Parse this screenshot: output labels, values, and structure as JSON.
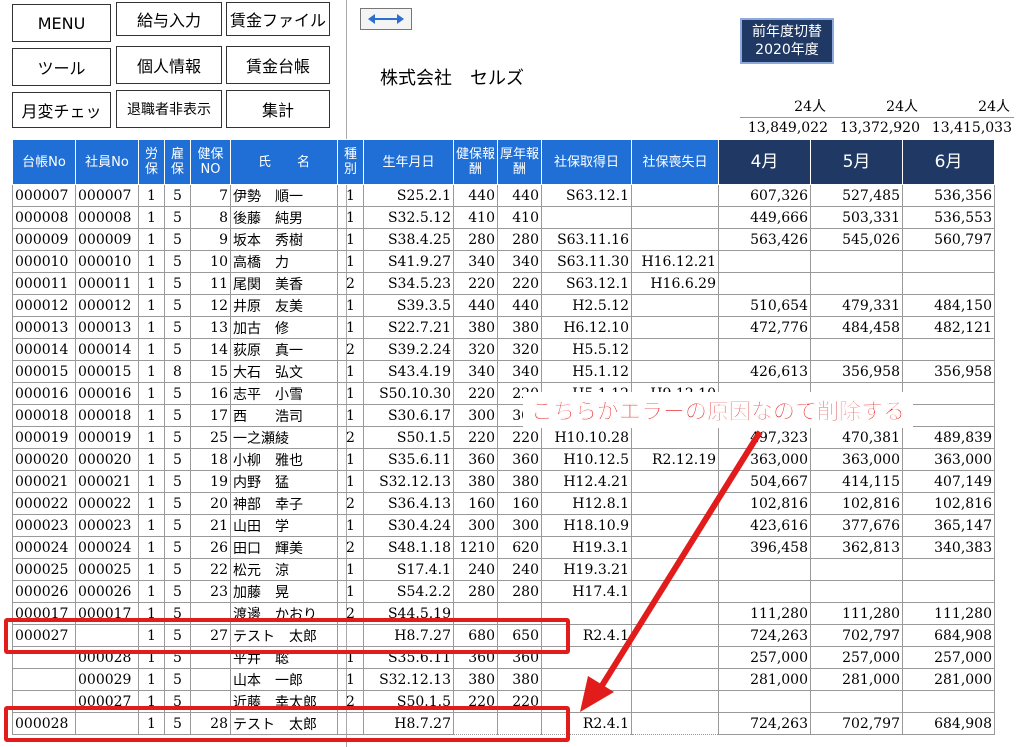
{
  "buttons": {
    "menu": "MENU",
    "salary_input": "給与入力",
    "wage_file": "賃金ファイル",
    "tools": "ツール",
    "personal_info": "個人情報",
    "wage_ledger": "賃金台帳",
    "monthly_change_check": "月変チェッ",
    "hide_retired": "退職者非表示",
    "aggregate": "集計"
  },
  "prev_year": {
    "line1": "前年度切替",
    "line2": "2020年度"
  },
  "company_name": "株式会社　セルズ",
  "headcount": [
    "24人",
    "24人",
    "24人"
  ],
  "totals": [
    "13,849,022",
    "13,372,920",
    "13,415,033"
  ],
  "columns": [
    "台帳No",
    "社員No",
    "労保",
    "雇保",
    "健保NO",
    "氏　　名",
    "種別",
    "生年月日",
    "健保報酬",
    "厚年報酬",
    "社保取得日",
    "社保喪失日",
    "4月",
    "5月",
    "6月"
  ],
  "rows": [
    [
      "000007",
      "000007",
      "1",
      "5",
      "7",
      "伊勢　順一",
      "1",
      "S25.2.1",
      "440",
      "440",
      "S63.12.1",
      "",
      "607,326",
      "527,485",
      "536,356"
    ],
    [
      "000008",
      "000008",
      "1",
      "5",
      "8",
      "後藤　純男",
      "1",
      "S32.5.12",
      "410",
      "410",
      "",
      "",
      "449,666",
      "503,331",
      "536,553"
    ],
    [
      "000009",
      "000009",
      "1",
      "5",
      "9",
      "坂本　秀樹",
      "1",
      "S38.4.25",
      "280",
      "280",
      "S63.11.16",
      "",
      "563,426",
      "545,026",
      "560,797"
    ],
    [
      "000010",
      "000010",
      "1",
      "5",
      "10",
      "高橋　力",
      "1",
      "S41.9.27",
      "340",
      "340",
      "S63.11.30",
      "H16.12.21",
      "",
      "",
      ""
    ],
    [
      "000011",
      "000011",
      "1",
      "5",
      "11",
      "尾関　美香",
      "2",
      "S34.5.23",
      "220",
      "220",
      "S63.12.1",
      "H16.6.29",
      "",
      "",
      ""
    ],
    [
      "000012",
      "000012",
      "1",
      "5",
      "12",
      "井原　友美",
      "1",
      "S39.3.5",
      "440",
      "440",
      "H2.5.12",
      "",
      "510,654",
      "479,331",
      "484,150"
    ],
    [
      "000013",
      "000013",
      "1",
      "5",
      "13",
      "加古　修",
      "1",
      "S22.7.21",
      "380",
      "380",
      "H6.12.10",
      "",
      "472,776",
      "484,458",
      "482,121"
    ],
    [
      "000014",
      "000014",
      "1",
      "5",
      "14",
      "荻原　真一",
      "2",
      "S39.2.24",
      "320",
      "320",
      "H5.5.12",
      "",
      "",
      "",
      ""
    ],
    [
      "000015",
      "000015",
      "1",
      "8",
      "15",
      "大石　弘文",
      "1",
      "S43.4.19",
      "340",
      "340",
      "H5.1.12",
      "",
      "426,613",
      "356,958",
      "356,958"
    ],
    [
      "000016",
      "000016",
      "1",
      "5",
      "16",
      "志平　小雪",
      "1",
      "S50.10.30",
      "220",
      "220",
      "H5.1.12",
      "H9.12.10",
      "",
      "",
      ""
    ],
    [
      "000018",
      "000018",
      "1",
      "5",
      "17",
      "西　　浩司",
      "1",
      "S30.6.17",
      "300",
      "300",
      "H9.2.21",
      "",
      "",
      "",
      ""
    ],
    [
      "000019",
      "000019",
      "1",
      "5",
      "25",
      "一之瀬綾",
      "2",
      "S50.1.5",
      "220",
      "220",
      "H10.10.28",
      "",
      "497,323",
      "470,381",
      "489,839"
    ],
    [
      "000020",
      "000020",
      "1",
      "5",
      "18",
      "小柳　雅也",
      "1",
      "S35.6.11",
      "360",
      "360",
      "H10.12.5",
      "R2.12.19",
      "363,000",
      "363,000",
      "363,000"
    ],
    [
      "000021",
      "000021",
      "1",
      "5",
      "19",
      "内野　猛",
      "1",
      "S32.12.13",
      "380",
      "380",
      "H12.4.21",
      "",
      "504,667",
      "414,115",
      "407,149"
    ],
    [
      "000022",
      "000022",
      "1",
      "5",
      "20",
      "神部　幸子",
      "2",
      "S36.4.13",
      "160",
      "160",
      "H12.8.1",
      "",
      "102,816",
      "102,816",
      "102,816"
    ],
    [
      "000023",
      "000023",
      "1",
      "5",
      "21",
      "山田　学",
      "1",
      "S30.4.24",
      "300",
      "300",
      "H18.10.9",
      "",
      "423,616",
      "377,676",
      "365,147"
    ],
    [
      "000024",
      "000024",
      "1",
      "5",
      "26",
      "田口　輝美",
      "2",
      "S48.1.18",
      "1210",
      "620",
      "H19.3.1",
      "",
      "396,458",
      "362,813",
      "340,383"
    ],
    [
      "000025",
      "000025",
      "1",
      "5",
      "22",
      "松元　涼",
      "1",
      "S17.4.1",
      "240",
      "240",
      "H19.3.21",
      "",
      "",
      "",
      ""
    ],
    [
      "000026",
      "000026",
      "1",
      "5",
      "23",
      "加藤　晃",
      "1",
      "S54.2.2",
      "280",
      "280",
      "H17.4.1",
      "",
      "",
      "",
      ""
    ],
    [
      "000017",
      "000017",
      "1",
      "5",
      "",
      "渡邊　かおり",
      "2",
      "S44.5.19",
      "",
      "",
      "",
      "",
      "111,280",
      "111,280",
      "111,280"
    ],
    [
      "000027",
      "",
      "1",
      "5",
      "27",
      "テスト　太郎",
      "",
      "H8.7.27",
      "680",
      "650",
      "R2.4.1",
      "",
      "724,263",
      "702,797",
      "684,908"
    ],
    [
      "",
      "000028",
      "1",
      "5",
      "",
      "平井　聡",
      "1",
      "S35.6.11",
      "360",
      "360",
      "",
      "",
      "257,000",
      "257,000",
      "257,000"
    ],
    [
      "",
      "000029",
      "1",
      "5",
      "",
      "山本　一郎",
      "1",
      "S32.12.13",
      "380",
      "380",
      "",
      "",
      "281,000",
      "281,000",
      "281,000"
    ],
    [
      "",
      "000027",
      "1",
      "5",
      "",
      "近藤　幸太郎",
      "2",
      "S50.1.5",
      "220",
      "220",
      "",
      "",
      "",
      "",
      ""
    ],
    [
      "000028",
      "",
      "1",
      "5",
      "28",
      "テスト　太郎",
      "",
      "H8.7.27",
      "",
      "",
      "R2.4.1",
      "",
      "724,263",
      "702,797",
      "684,908"
    ]
  ],
  "annotation": "こちらがエラーの原因なので削除する",
  "accent_red": "#e21b1b",
  "header_blue": "#1f6fd6",
  "header_navy": "#1f3864"
}
